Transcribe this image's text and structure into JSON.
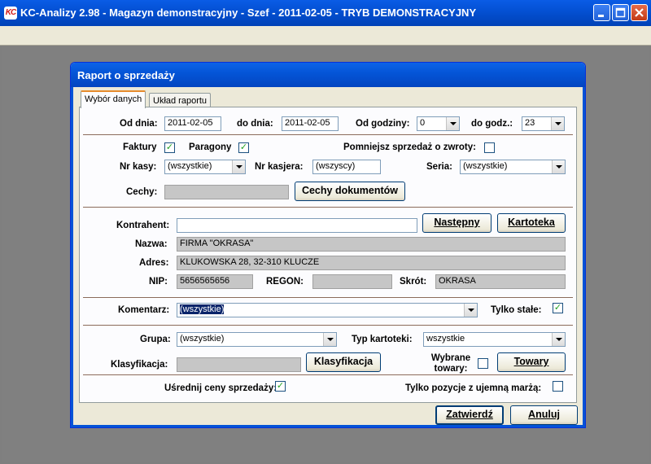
{
  "window": {
    "title": "KC-Analizy 2.98 - Magazyn demonstracyjny - Szef - 2011-02-05 - TRYB DEMONSTRACYJNY",
    "icon_text": "KC"
  },
  "dialog": {
    "title": "Raport o sprzedaży",
    "tabs": [
      "Wybór danych",
      "Układ raportu"
    ],
    "active_tab": "Wybór danych"
  },
  "dates": {
    "from_label": "Od dnia:",
    "from_value": "2011-02-05",
    "to_label": "do dnia:",
    "to_value": "2011-02-05",
    "hour_from_label": "Od godziny:",
    "hour_from_value": "0",
    "hour_to_label": "do godz.:",
    "hour_to_value": "23"
  },
  "docs": {
    "invoices_label": "Faktury",
    "invoices_checked": true,
    "receipts_label": "Paragony",
    "receipts_checked": true,
    "returns_label": "Pomniejsz sprzedaż o zwroty:",
    "returns_checked": false,
    "register_label": "Nr kasy:",
    "register_value": "(wszystkie)",
    "cashier_label": "Nr kasjera:",
    "cashier_value": "(wszyscy)",
    "series_label": "Seria:",
    "series_value": "(wszystkie)",
    "features_label": "Cechy:",
    "features_value": "",
    "features_button": "Cechy dokumentów"
  },
  "contractor": {
    "label": "Kontrahent:",
    "value": "",
    "next_button": "Następny",
    "card_button": "Kartoteka",
    "name_label": "Nazwa:",
    "name_value": "FIRMA \"OKRASA\"",
    "address_label": "Adres:",
    "address_value": "KLUKOWSKA 28, 32-310 KLUCZE",
    "nip_label": "NIP:",
    "nip_value": "5656565656",
    "regon_label": "REGON:",
    "regon_value": "",
    "short_label": "Skrót:",
    "short_value": "OKRASA"
  },
  "comment": {
    "label": "Komentarz:",
    "value": "(wszystkie)",
    "only_fixed_label": "Tylko stałe:",
    "only_fixed_checked": true
  },
  "goods": {
    "group_label": "Grupa:",
    "group_value": "(wszystkie)",
    "card_type_label": "Typ kartoteki:",
    "card_type_value": "wszystkie",
    "classification_label": "Klasyfikacja:",
    "classification_value": "",
    "classification_button": "Klasyfikacja",
    "selected_label_1": "Wybrane",
    "selected_label_2": "towary:",
    "selected_checked": false,
    "goods_button": "Towary"
  },
  "options": {
    "avg_prices_label": "Uśrednij ceny sprzedaży:",
    "avg_prices_checked": true,
    "negative_margin_label": "Tylko pozycje z ujemną marżą:",
    "negative_margin_checked": false
  },
  "footer": {
    "ok_button": "Zatwierdź",
    "cancel_button": "Anuluj"
  },
  "colors": {
    "titlebar": "#0454d6",
    "dialog_bg": "#ece9d8",
    "panel_bg": "#fcfcfe",
    "checkmark": "#21a121"
  }
}
